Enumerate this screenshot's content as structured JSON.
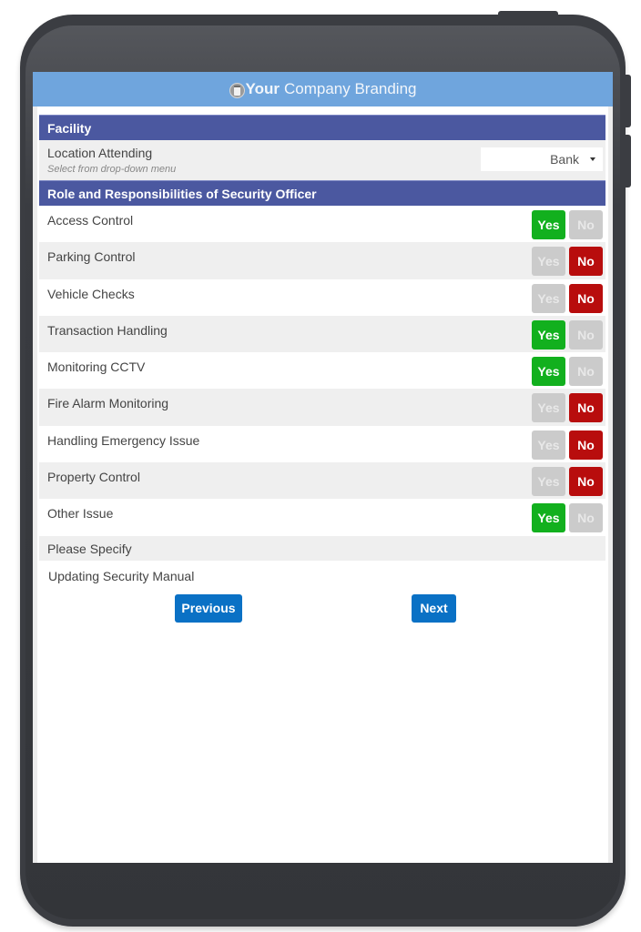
{
  "branding": {
    "logo_icon": "branding-logo-icon",
    "strong": "Your",
    "rest": "Company Branding"
  },
  "facility": {
    "header": "Facility",
    "location_label": "Location Attending",
    "location_hint": "Select from drop-down menu",
    "location_value": "Bank"
  },
  "roles": {
    "header": "Role and Responsibilities of Security Officer",
    "yes_label": "Yes",
    "no_label": "No",
    "items": [
      {
        "label": "Access Control",
        "answer": "yes"
      },
      {
        "label": "Parking Control",
        "answer": "no"
      },
      {
        "label": "Vehicle Checks",
        "answer": "no"
      },
      {
        "label": "Transaction Handling",
        "answer": "yes"
      },
      {
        "label": "Monitoring CCTV",
        "answer": "yes"
      },
      {
        "label": "Fire Alarm Monitoring",
        "answer": "no"
      },
      {
        "label": "Handling Emergency Issue",
        "answer": "no"
      },
      {
        "label": "Property Control",
        "answer": "no"
      },
      {
        "label": "Other Issue",
        "answer": "yes"
      }
    ],
    "specify_label": "Please Specify",
    "specify_value": "Updating Security Manual"
  },
  "nav": {
    "previous_label": "Previous",
    "next_label": "Next"
  },
  "colors": {
    "brand_bar": "#6fa5dd",
    "section_header": "#4b58a0",
    "yes_active": "#12b01e",
    "no_active": "#b80d0d",
    "inactive": "#cbcbcb",
    "nav_button": "#0a71c5"
  }
}
